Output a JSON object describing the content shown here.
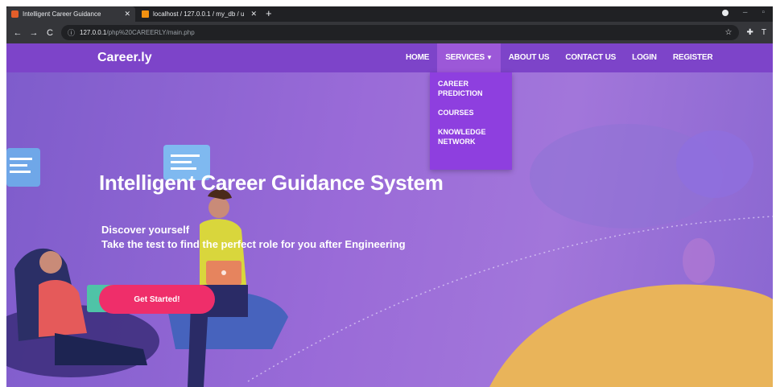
{
  "browser": {
    "tabs": [
      {
        "title": "Intelligent Career Guidance",
        "active": true
      },
      {
        "title": "localhost / 127.0.0.1 / my_db / u",
        "active": false
      }
    ],
    "url_host": "127.0.0.1",
    "url_path": "/php%20CAREERLY/main.php"
  },
  "site": {
    "brand": "Career.ly",
    "nav": {
      "home": "HOME",
      "services": "SERVICES",
      "about": "ABOUT US",
      "contact": "CONTACT US",
      "login": "LOGIN",
      "register": "REGISTER"
    },
    "dropdown": {
      "career_line1": "CAREER",
      "career_line2": "PREDICTION",
      "courses": "COURSES",
      "knowledge_line1": "KNOWLEDGE",
      "knowledge_line2": "NETWORK"
    }
  },
  "hero": {
    "title": "Intelligent Career Guidance System",
    "line1": "Discover yourself",
    "line2": "Take the test to find the perfect role for you after Engineering",
    "cta": "Get Started!"
  },
  "colors": {
    "navbar": "#7d44c9",
    "dropdown": "#8e3fdf",
    "cta": "#ef2e6a"
  }
}
